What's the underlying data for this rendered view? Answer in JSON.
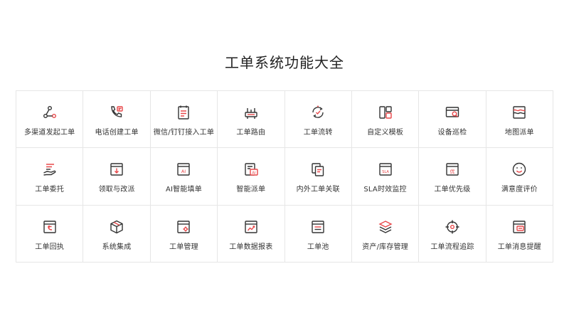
{
  "page": {
    "title": "工单系统功能大全"
  },
  "features": [
    {
      "label": "多渠道发起工单",
      "icon": "multi-channel-icon"
    },
    {
      "label": "电话创建工单",
      "icon": "phone-ticket-icon"
    },
    {
      "label": "微信/钉钉接入工单",
      "icon": "wechat-dingtalk-icon"
    },
    {
      "label": "工单路由",
      "icon": "router-icon"
    },
    {
      "label": "工单流转",
      "icon": "flow-cycle-icon"
    },
    {
      "label": "自定义模板",
      "icon": "template-icon"
    },
    {
      "label": "设备巡检",
      "icon": "inspection-icon"
    },
    {
      "label": "地图派单",
      "icon": "map-icon"
    },
    {
      "label": "工单委托",
      "icon": "delegate-icon"
    },
    {
      "label": "领取与改派",
      "icon": "claim-icon"
    },
    {
      "label": "AI智能填单",
      "icon": "ai-fill-icon"
    },
    {
      "label": "智能派单",
      "icon": "smart-dispatch-icon"
    },
    {
      "label": "内外工单关联",
      "icon": "link-tickets-icon"
    },
    {
      "label": "SLA时效监控",
      "icon": "sla-icon"
    },
    {
      "label": "工单优先级",
      "icon": "priority-icon"
    },
    {
      "label": "满意度评价",
      "icon": "smiley-icon"
    },
    {
      "label": "工单回执",
      "icon": "receipt-icon"
    },
    {
      "label": "系统集成",
      "icon": "integration-cube-icon"
    },
    {
      "label": "工单管理",
      "icon": "manage-gear-icon"
    },
    {
      "label": "工单数据报表",
      "icon": "report-chart-icon"
    },
    {
      "label": "工单池",
      "icon": "pool-icon"
    },
    {
      "label": "资产/库存管理",
      "icon": "layers-icon"
    },
    {
      "label": "工单流程追踪",
      "icon": "target-icon"
    },
    {
      "label": "工单消息提醒",
      "icon": "message-icon"
    }
  ],
  "icon_badges": {
    "ai": "AI",
    "sla": "SLA",
    "priority": "优"
  },
  "colors": {
    "accent": "#e8484a",
    "stroke": "#333333",
    "border": "#e6e6e6"
  }
}
